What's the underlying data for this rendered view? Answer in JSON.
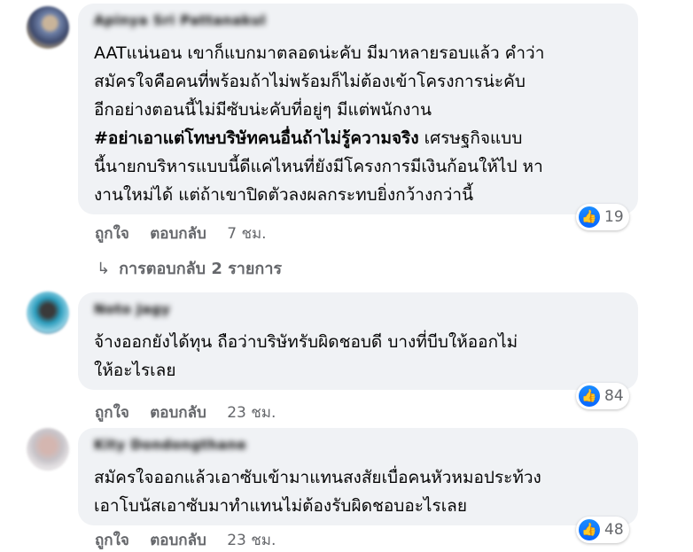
{
  "comments": [
    {
      "author": "Apinya Sri Pattanakul",
      "text_lines": [
        "AATแน่นอน เขาก็แบกมาตลอดน่ะคับ มีมาหลายรอบแล้ว คำว่า",
        "สมัครใจคือคนที่พร้อมถ้าไม่พร้อมก็ไม่ต้องเข้าโครงการน่ะคับ",
        "อีกอย่างตอนนี้ไม่มีซับน่ะคับที่อยู่ๆ มีแต่พนักงาน"
      ],
      "hashtag": "#อย่าเอาแต่โทษบริษัทคนอื่นถ้าไม่รู้ความจริง",
      "hashtag_tail": " เศรษฐกิจแบบ",
      "text_lines_after": [
        "นี้นายกบริหารแบบนี้ดีแค่ไหนที่ยังมีโครงการมีเงินก้อนให้ไป หา",
        "งานใหม่ได้ แต่ถ้าเขาปิดตัวลงผลกระทบยิ่งกว้างกว่านี้"
      ],
      "like_label": "ถูกใจ",
      "reply_label": "ตอบกลับ",
      "time": "7 ชม.",
      "reactions": "19"
    },
    {
      "author": "Noto Jagy",
      "text_lines": [
        "จ้างออกยังได้ทุน ถือว่าบริษัทรับผิดชอบดี บางที่บีบให้ออกไม่",
        "ให้อะไรเลย"
      ],
      "like_label": "ถูกใจ",
      "reply_label": "ตอบกลับ",
      "time": "23 ชม.",
      "reactions": "84"
    },
    {
      "author": "Kity Dondongthane",
      "text_lines": [
        "สมัครใจออกแล้วเอาซับเข้ามาแทนสงสัยเบื่อคนหัวหมอประท้วง",
        "เอาโบนัสเอาซับมาทำแทนไม่ต้องรับผิดชอบอะไรเลย"
      ],
      "like_label": "ถูกใจ",
      "reply_label": "ตอบกลับ",
      "time": "23 ชม.",
      "reactions": "48"
    }
  ],
  "replies_link": "การตอบกลับ 2 รายการ",
  "icons": {
    "reply_arrow": "reply-arrow-icon",
    "like": "thumbs-up-icon"
  },
  "colors": {
    "bubble": "#f0f2f5",
    "like_blue": "#0866ff",
    "meta_gray": "#65676b"
  }
}
